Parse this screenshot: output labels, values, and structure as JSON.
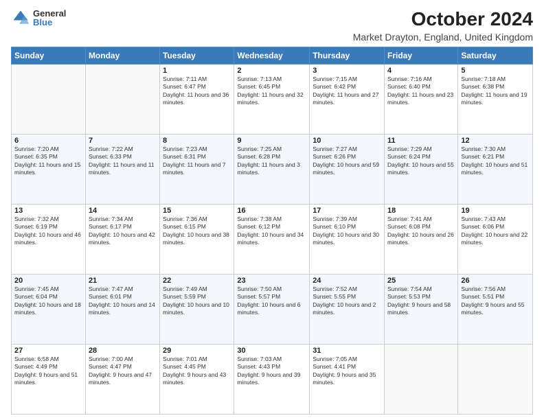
{
  "header": {
    "logo_general": "General",
    "logo_blue": "Blue",
    "title": "October 2024",
    "subtitle": "Market Drayton, England, United Kingdom"
  },
  "days_of_week": [
    "Sunday",
    "Monday",
    "Tuesday",
    "Wednesday",
    "Thursday",
    "Friday",
    "Saturday"
  ],
  "weeks": [
    [
      {
        "day": "",
        "info": ""
      },
      {
        "day": "",
        "info": ""
      },
      {
        "day": "1",
        "info": "Sunrise: 7:11 AM\nSunset: 6:47 PM\nDaylight: 11 hours and 36 minutes."
      },
      {
        "day": "2",
        "info": "Sunrise: 7:13 AM\nSunset: 6:45 PM\nDaylight: 11 hours and 32 minutes."
      },
      {
        "day": "3",
        "info": "Sunrise: 7:15 AM\nSunset: 6:42 PM\nDaylight: 11 hours and 27 minutes."
      },
      {
        "day": "4",
        "info": "Sunrise: 7:16 AM\nSunset: 6:40 PM\nDaylight: 11 hours and 23 minutes."
      },
      {
        "day": "5",
        "info": "Sunrise: 7:18 AM\nSunset: 6:38 PM\nDaylight: 11 hours and 19 minutes."
      }
    ],
    [
      {
        "day": "6",
        "info": "Sunrise: 7:20 AM\nSunset: 6:35 PM\nDaylight: 11 hours and 15 minutes."
      },
      {
        "day": "7",
        "info": "Sunrise: 7:22 AM\nSunset: 6:33 PM\nDaylight: 11 hours and 11 minutes."
      },
      {
        "day": "8",
        "info": "Sunrise: 7:23 AM\nSunset: 6:31 PM\nDaylight: 11 hours and 7 minutes."
      },
      {
        "day": "9",
        "info": "Sunrise: 7:25 AM\nSunset: 6:28 PM\nDaylight: 11 hours and 3 minutes."
      },
      {
        "day": "10",
        "info": "Sunrise: 7:27 AM\nSunset: 6:26 PM\nDaylight: 10 hours and 59 minutes."
      },
      {
        "day": "11",
        "info": "Sunrise: 7:29 AM\nSunset: 6:24 PM\nDaylight: 10 hours and 55 minutes."
      },
      {
        "day": "12",
        "info": "Sunrise: 7:30 AM\nSunset: 6:21 PM\nDaylight: 10 hours and 51 minutes."
      }
    ],
    [
      {
        "day": "13",
        "info": "Sunrise: 7:32 AM\nSunset: 6:19 PM\nDaylight: 10 hours and 46 minutes."
      },
      {
        "day": "14",
        "info": "Sunrise: 7:34 AM\nSunset: 6:17 PM\nDaylight: 10 hours and 42 minutes."
      },
      {
        "day": "15",
        "info": "Sunrise: 7:36 AM\nSunset: 6:15 PM\nDaylight: 10 hours and 38 minutes."
      },
      {
        "day": "16",
        "info": "Sunrise: 7:38 AM\nSunset: 6:12 PM\nDaylight: 10 hours and 34 minutes."
      },
      {
        "day": "17",
        "info": "Sunrise: 7:39 AM\nSunset: 6:10 PM\nDaylight: 10 hours and 30 minutes."
      },
      {
        "day": "18",
        "info": "Sunrise: 7:41 AM\nSunset: 6:08 PM\nDaylight: 10 hours and 26 minutes."
      },
      {
        "day": "19",
        "info": "Sunrise: 7:43 AM\nSunset: 6:06 PM\nDaylight: 10 hours and 22 minutes."
      }
    ],
    [
      {
        "day": "20",
        "info": "Sunrise: 7:45 AM\nSunset: 6:04 PM\nDaylight: 10 hours and 18 minutes."
      },
      {
        "day": "21",
        "info": "Sunrise: 7:47 AM\nSunset: 6:01 PM\nDaylight: 10 hours and 14 minutes."
      },
      {
        "day": "22",
        "info": "Sunrise: 7:49 AM\nSunset: 5:59 PM\nDaylight: 10 hours and 10 minutes."
      },
      {
        "day": "23",
        "info": "Sunrise: 7:50 AM\nSunset: 5:57 PM\nDaylight: 10 hours and 6 minutes."
      },
      {
        "day": "24",
        "info": "Sunrise: 7:52 AM\nSunset: 5:55 PM\nDaylight: 10 hours and 2 minutes."
      },
      {
        "day": "25",
        "info": "Sunrise: 7:54 AM\nSunset: 5:53 PM\nDaylight: 9 hours and 58 minutes."
      },
      {
        "day": "26",
        "info": "Sunrise: 7:56 AM\nSunset: 5:51 PM\nDaylight: 9 hours and 55 minutes."
      }
    ],
    [
      {
        "day": "27",
        "info": "Sunrise: 6:58 AM\nSunset: 4:49 PM\nDaylight: 9 hours and 51 minutes."
      },
      {
        "day": "28",
        "info": "Sunrise: 7:00 AM\nSunset: 4:47 PM\nDaylight: 9 hours and 47 minutes."
      },
      {
        "day": "29",
        "info": "Sunrise: 7:01 AM\nSunset: 4:45 PM\nDaylight: 9 hours and 43 minutes."
      },
      {
        "day": "30",
        "info": "Sunrise: 7:03 AM\nSunset: 4:43 PM\nDaylight: 9 hours and 39 minutes."
      },
      {
        "day": "31",
        "info": "Sunrise: 7:05 AM\nSunset: 4:41 PM\nDaylight: 9 hours and 35 minutes."
      },
      {
        "day": "",
        "info": ""
      },
      {
        "day": "",
        "info": ""
      }
    ]
  ]
}
